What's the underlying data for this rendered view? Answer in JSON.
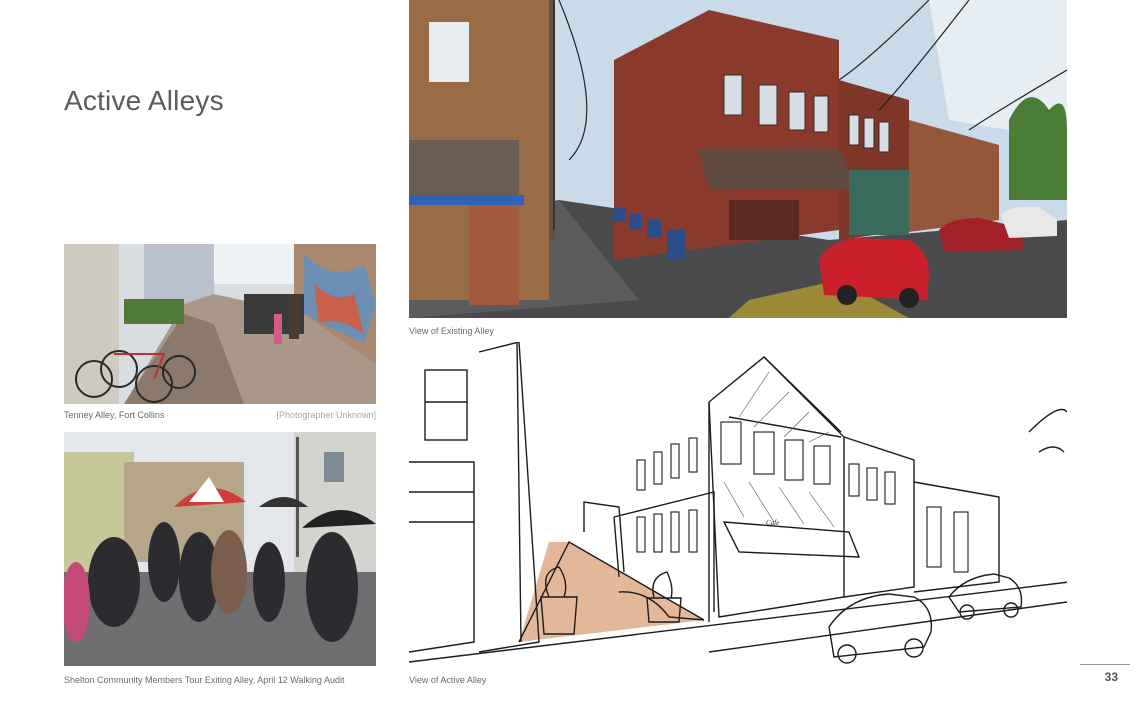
{
  "page": {
    "title": "Active Alleys",
    "page_number": "33"
  },
  "photos": {
    "tenney": {
      "caption": "Tenney Alley, Fort Collins",
      "credit": "[Photographer Unknown]"
    },
    "shelton": {
      "caption": "Shelton Community Members Tour Exiting Alley, April 12 Walking Audit"
    },
    "existing": {
      "caption": "View of Existing Alley"
    },
    "active": {
      "caption": "View of Active Alley",
      "sign_text": "Cafe"
    }
  },
  "colors": {
    "brick": "#8a3a2c",
    "sky": "#c9dbe9",
    "paving": "#e3b89a",
    "text": "#5b5b5b"
  }
}
